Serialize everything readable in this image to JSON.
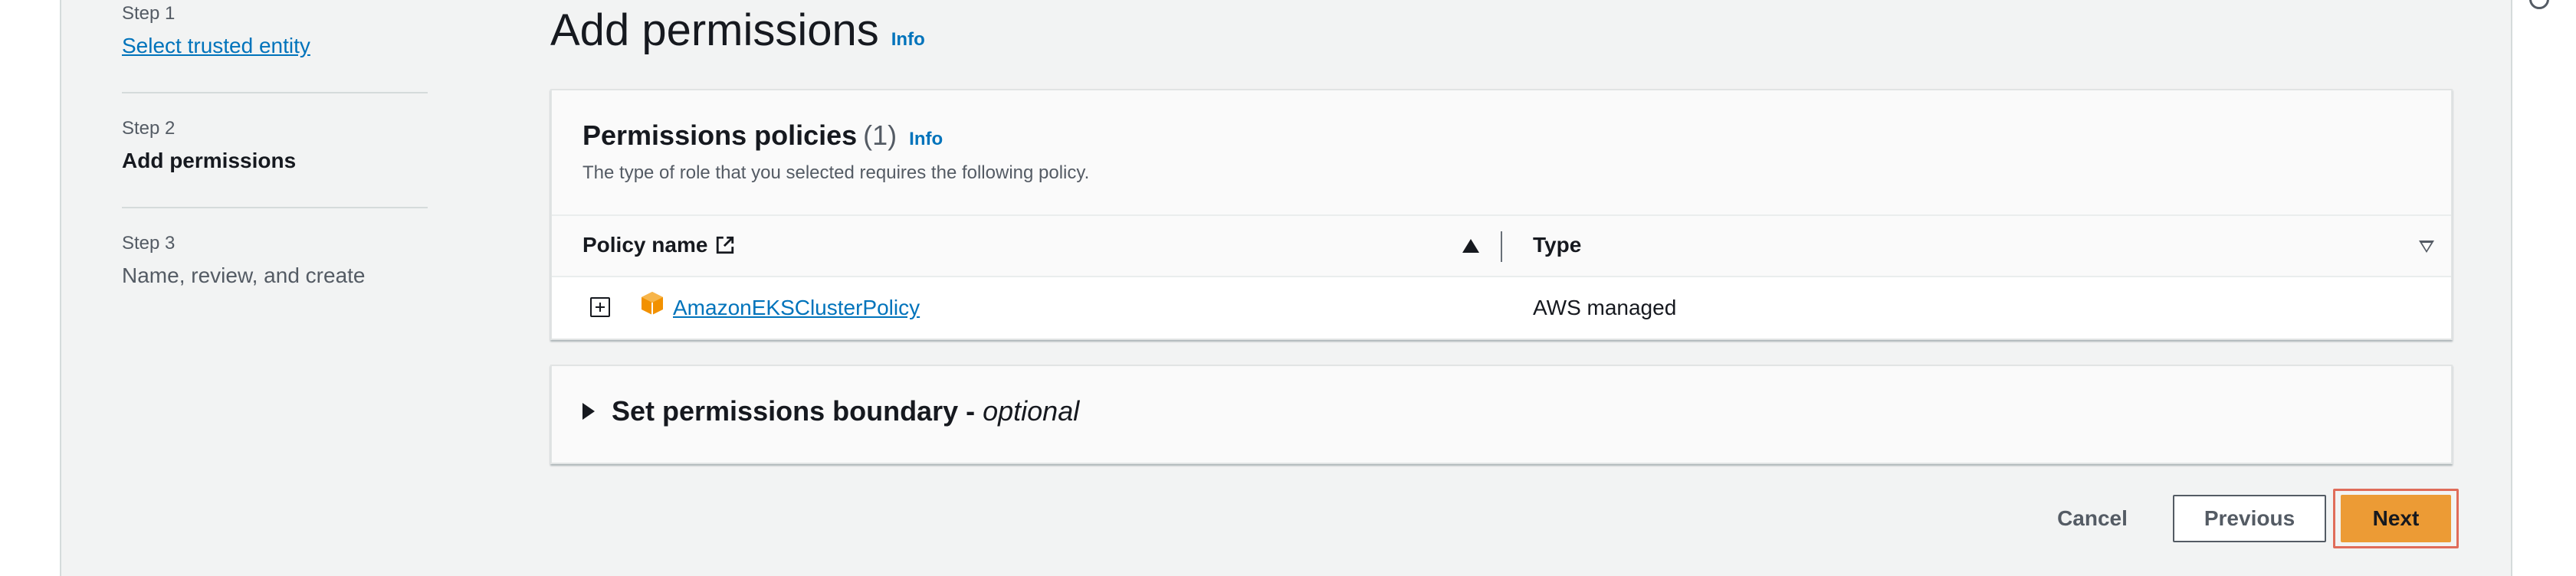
{
  "steps": [
    {
      "label": "Step 1",
      "title": "Select trusted entity",
      "state": "link"
    },
    {
      "label": "Step 2",
      "title": "Add permissions",
      "state": "current"
    },
    {
      "label": "Step 3",
      "title": "Name, review, and create",
      "state": "upcoming"
    }
  ],
  "page": {
    "title": "Add permissions",
    "info": "Info"
  },
  "policies": {
    "title": "Permissions policies",
    "count": "(1)",
    "info": "Info",
    "description": "The type of role that you selected requires the following policy.",
    "columns": {
      "name": "Policy name",
      "type": "Type"
    },
    "rows": [
      {
        "name": "AmazonEKSClusterPolicy",
        "type": "AWS managed",
        "icon": "aws-managed-policy-icon"
      }
    ]
  },
  "boundary": {
    "title": "Set permissions boundary -",
    "optional": "optional"
  },
  "footer": {
    "cancel": "Cancel",
    "previous": "Previous",
    "next": "Next"
  },
  "colors": {
    "link": "#0073bb",
    "primary_button": "#ec9b35",
    "background": "#f2f3f3",
    "highlight": "#e06c5a"
  }
}
